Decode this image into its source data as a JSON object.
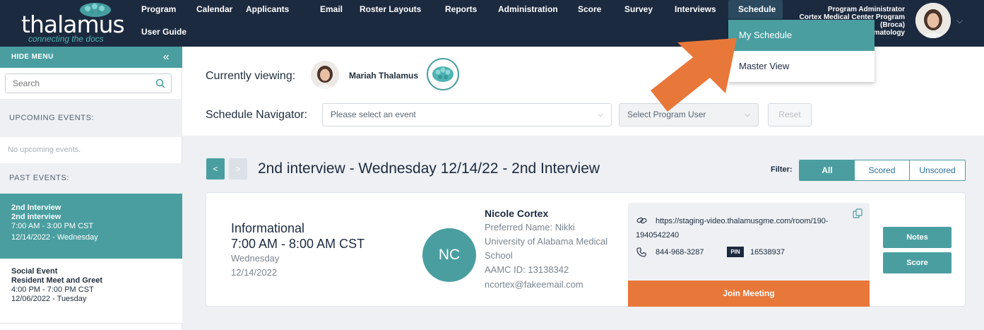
{
  "app": {
    "logo_text": "thalamus",
    "logo_tagline": "connecting the docs"
  },
  "nav": {
    "items": [
      "Program",
      "Calendar",
      "Applicants",
      "Email",
      "Roster Layouts",
      "Reports",
      "Administration",
      "Score",
      "Survey",
      "Interviews",
      "Schedule"
    ],
    "second_row": [
      "User Guide"
    ]
  },
  "user": {
    "role": "Program Administrator",
    "org": "Cortex Medical Center Program",
    "sub": "(Broca)",
    "dept": "rmatology"
  },
  "schedule_menu": {
    "items": [
      "My Schedule",
      "Master View"
    ]
  },
  "sidebar": {
    "hide_label": "HIDE MENU",
    "search_placeholder": "Search",
    "upcoming_label": "UPCOMING EVENTS:",
    "no_upcoming": "No upcoming events.",
    "past_label": "PAST EVENTS:",
    "events": [
      {
        "type": "2nd Interview",
        "name": "2nd interview",
        "time": "7:00 AM - 3:00 PM CST",
        "date": "12/14/2022 - Wednesday"
      },
      {
        "type": "Social Event",
        "name": "Resident Meet and Greet",
        "time": "4:00 PM - 7:00 PM CST",
        "date": "12/06/2022 - Tuesday"
      }
    ]
  },
  "viewing": {
    "label": "Currently viewing:",
    "name": "Mariah Thalamus"
  },
  "navigator": {
    "label": "Schedule Navigator:",
    "event_placeholder": "Please select an event",
    "user_placeholder": "Select Program User",
    "reset_label": "Reset"
  },
  "schedule": {
    "title": "2nd interview - Wednesday 12/14/22 - 2nd Interview",
    "filter_label": "Filter:",
    "filters": [
      "All",
      "Scored",
      "Unscored"
    ]
  },
  "appointment": {
    "type": "Informational",
    "time": "7:00 AM - 8:00 AM CST",
    "day": "Wednesday",
    "date": "12/14/2022",
    "initials": "NC",
    "candidate_name": "Nicole Cortex",
    "preferred_name": "Preferred Name: Nikki",
    "school_line1": "University of Alabama Medical",
    "school_line2": "School",
    "aamc_id": "AAMC ID: 13138342",
    "email": "ncortex@fakeemail.com",
    "meeting_url": "https://staging-video.thalamusgme.com/room/190-1940542240",
    "phone": "844-968-3287",
    "pin_label": "PIN",
    "pin": "16538937",
    "join_label": "Join Meeting",
    "notes_label": "Notes",
    "score_label": "Score"
  },
  "colors": {
    "header": "#1c2a3f",
    "teal": "#4a9ea0",
    "orange": "#e8773a"
  }
}
